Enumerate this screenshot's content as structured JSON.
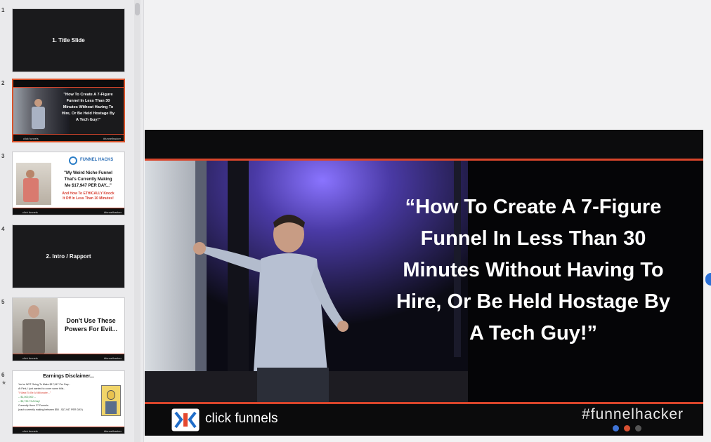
{
  "thumbnails": [
    {
      "number": "1",
      "title": "1. Title Slide"
    },
    {
      "number": "2",
      "quote_lines": [
        "\"How To Create A 7-Figure",
        "Funnel In Less Than 30",
        "Minutes Without Having To",
        "Hire, Or Be Held Hostage By",
        "A Tech Guy!\""
      ],
      "footer_left": "click funnels",
      "footer_right": "#funnelhacker"
    },
    {
      "number": "3",
      "brand": "FUNNEL HACKS",
      "quote_lines": [
        "\"My Weird Niche Funnel",
        "That's Currently Making",
        "Me $17,947 PER DAY...\""
      ],
      "red_lines": [
        "And How To ETHICALLY Knock",
        "It Off In Less Than 10 Minutes!"
      ],
      "footer_left": "click funnels",
      "footer_right": "#funnelhacker"
    },
    {
      "number": "4",
      "title": "2. Intro / Rapport"
    },
    {
      "number": "5",
      "lines": [
        "Don't Use These",
        "Powers For Evil..."
      ],
      "footer_left": "click funnels",
      "footer_right": "#funnelhacker"
    },
    {
      "number": "6",
      "marker": "★",
      "title": "Earnings Disclaimer...",
      "bullets": [
        "You're NOT Going To Make $17,947 Per Day...",
        "At First, I just wanted to cover some bills...",
        "\"I Want To Be A Millionaire...\"",
        "-- $1,000,000 --",
        "-- $2,739.73 A Day!",
        "Currently Have 27 Funnels",
        "(each currently making between $50 - $17,947 PER DAY)"
      ],
      "footer_left": "click funnels",
      "footer_right": "#funnelhacker"
    }
  ],
  "slide": {
    "quote_lines": [
      "“How To Create A 7-Figure",
      "Funnel In Less Than 30",
      "Minutes Without Having To",
      "Hire, Or Be Held Hostage By",
      "A Tech Guy!”"
    ],
    "brand": "click funnels",
    "hashtag": "#funnelhacker"
  },
  "colors": {
    "accent": "#d9452b",
    "selection": "#d9532b"
  }
}
